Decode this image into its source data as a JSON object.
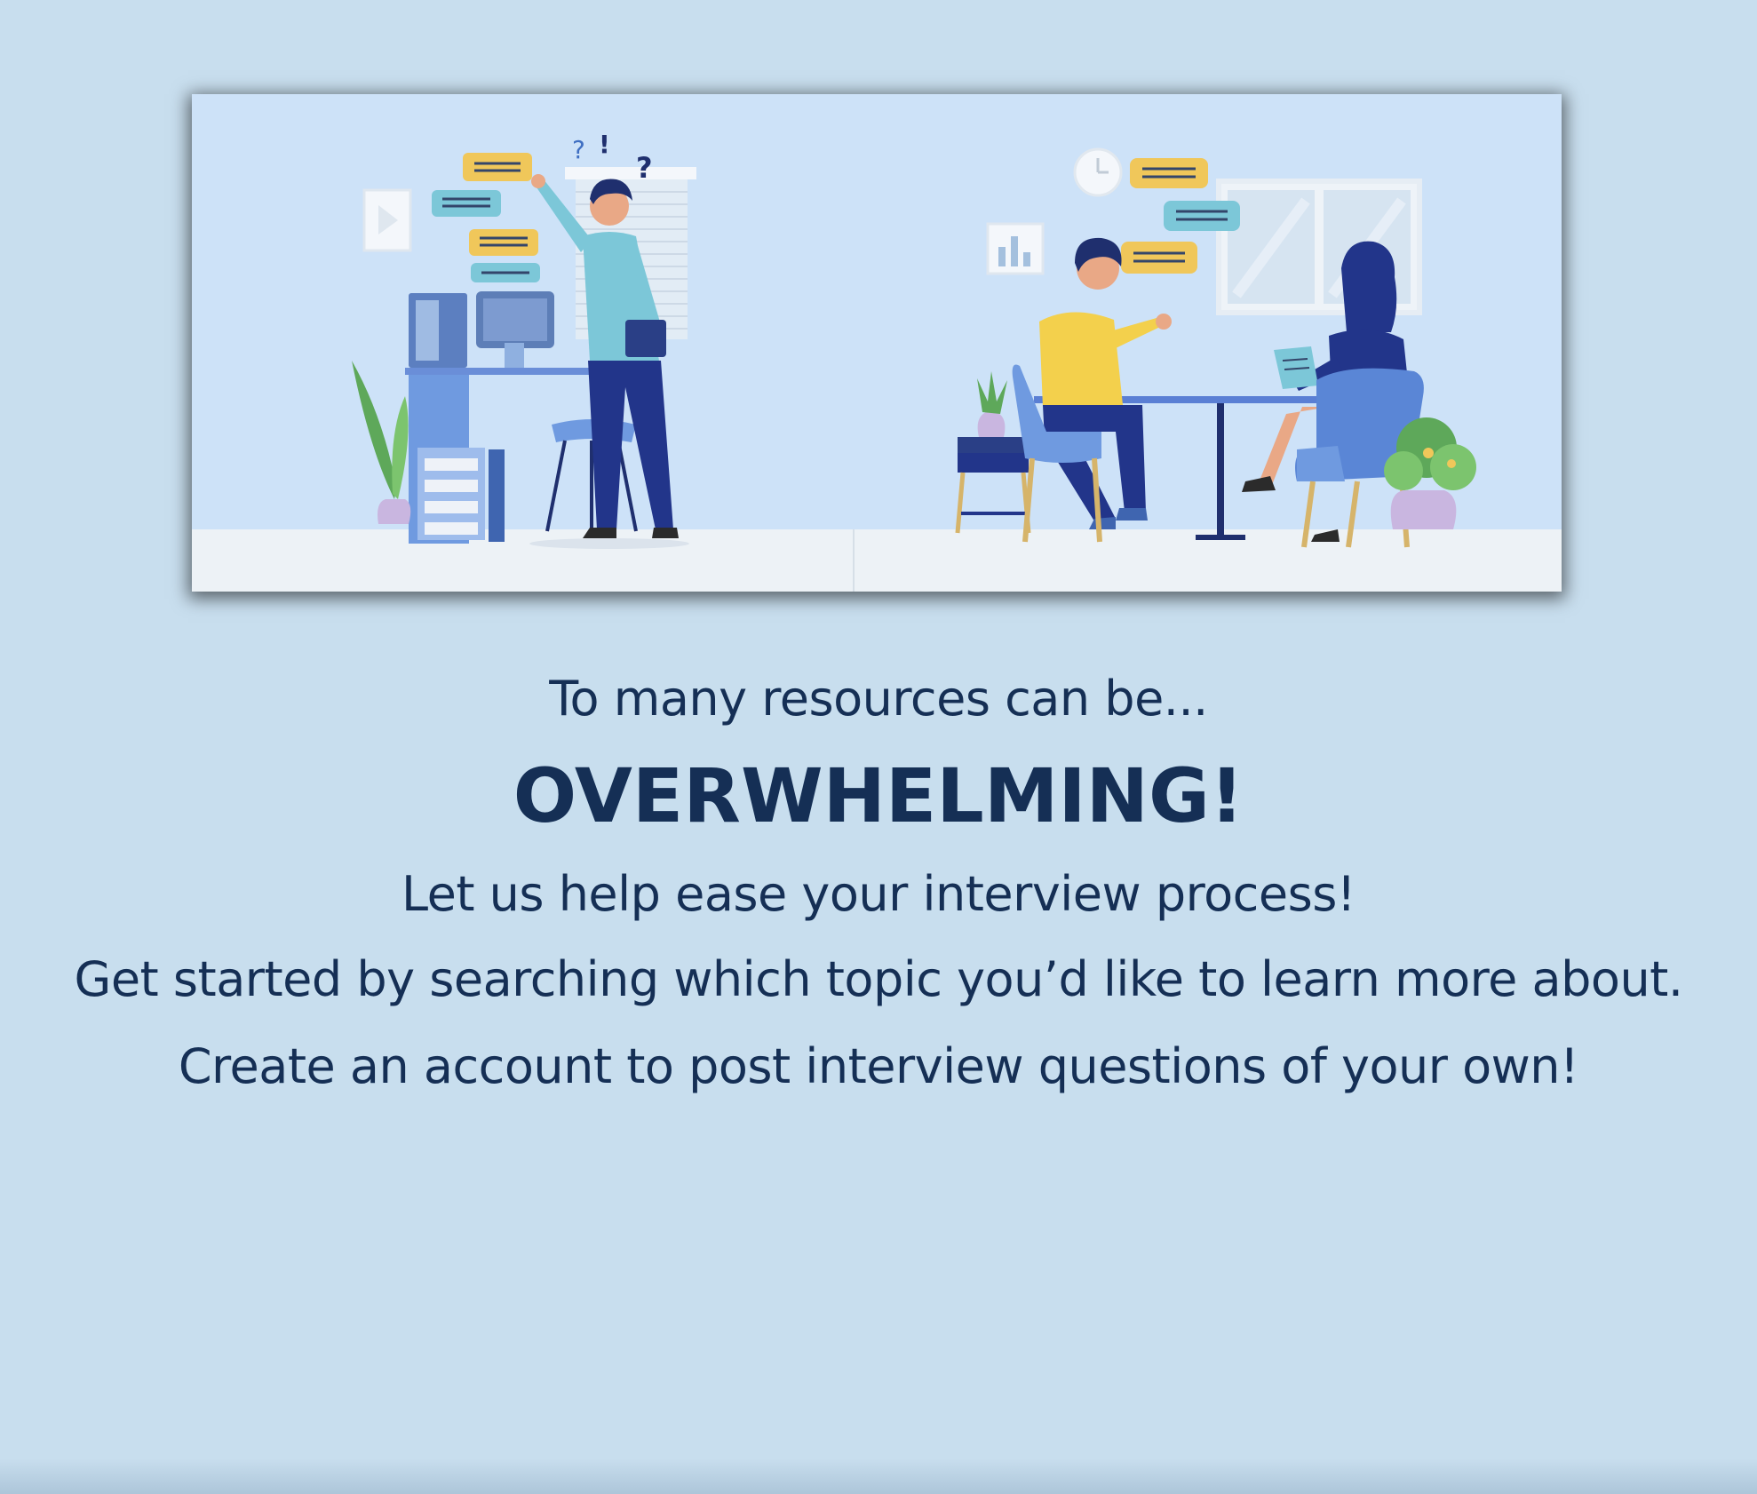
{
  "hero": {
    "illustration": "interview-illustration"
  },
  "text": {
    "intro": "To many resources can be...",
    "headline": "OVERWHELMING!",
    "line1": "Let us help ease your interview process!",
    "line2": "Get started by searching which topic you’d like to learn more about.",
    "line3": "Create an account to post interview questions of your own!"
  },
  "colors": {
    "page_bg": "#c8deee",
    "text": "#152f55",
    "hero_bg": "#cde2f8"
  }
}
